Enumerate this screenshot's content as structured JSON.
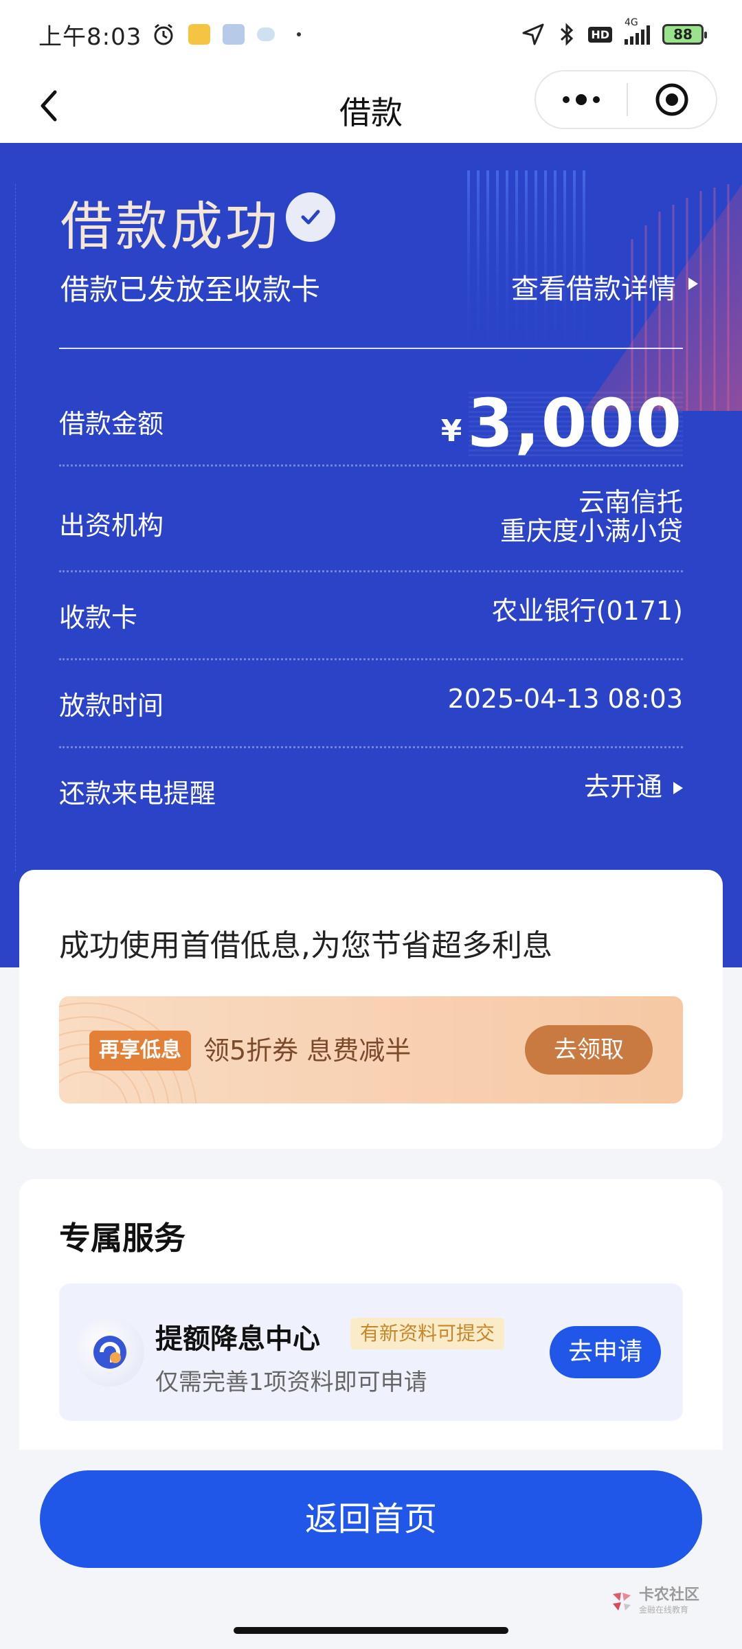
{
  "status_bar": {
    "time": "上午8:03",
    "network": "4G",
    "battery": "88",
    "hd": "HD"
  },
  "nav": {
    "title": "借款",
    "back_icon": "chevron-left-icon",
    "more_icon": "more-dots-icon",
    "close_icon": "target-close-icon"
  },
  "hero": {
    "success_title": "借款成功",
    "subtitle": "借款已发放至收款卡",
    "detail_link": "查看借款详情",
    "rows": {
      "amount_label": "借款金额",
      "amount_currency": "¥",
      "amount_value": "3,000",
      "lender_label": "出资机构",
      "lender_line1": "云南信托",
      "lender_line2": "重庆度小满小贷",
      "card_label": "收款卡",
      "card_value": "农业银行(0171)",
      "time_label": "放款时间",
      "time_value": "2025-04-13 08:03",
      "remind_label": "还款来电提醒",
      "remind_value": "去开通"
    }
  },
  "promo": {
    "title": "成功使用首借低息,为您节省超多利息",
    "tag": "再享低息",
    "text": "领5折券 息费减半",
    "button": "去领取"
  },
  "service": {
    "title": "专属服务",
    "item_name": "提额降息中心",
    "item_badge": "有新资料可提交",
    "item_desc": "仅需完善1项资料即可申请",
    "item_button": "去申请"
  },
  "bottom": {
    "home_button": "返回首页",
    "watermark": "卡农社区",
    "watermark_sub": "金融在线教育"
  },
  "colors": {
    "hero_bg": "#2a43c7",
    "primary_button": "#2157e8",
    "promo_button": "#c97a40",
    "promo_tag": "#e37f36"
  }
}
